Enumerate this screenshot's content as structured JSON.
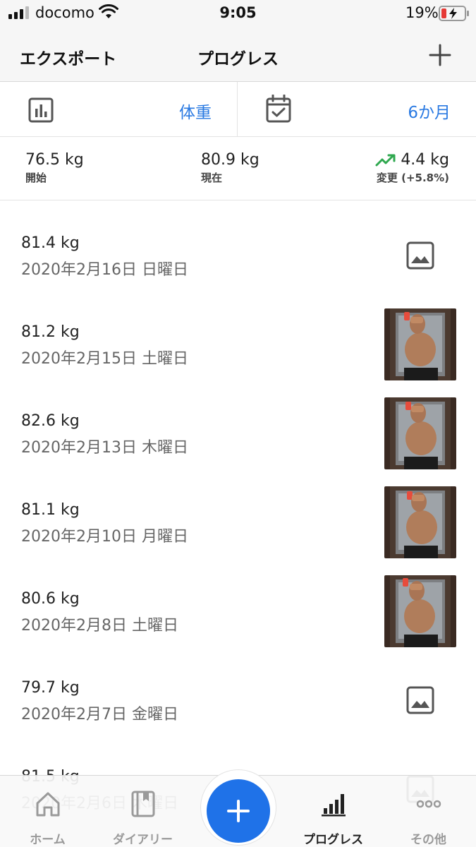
{
  "status_bar": {
    "carrier": "docomo",
    "time": "9:05",
    "battery_percent": "19%"
  },
  "nav": {
    "export_label": "エクスポート",
    "title": "プログレス",
    "add_icon": "plus-icon"
  },
  "filters": {
    "metric_icon": "bar-chart-icon",
    "metric": "体重",
    "period_icon": "calendar-check-icon",
    "period": "6か月"
  },
  "summary": {
    "start_value": "76.5 kg",
    "start_label": "開始",
    "current_value": "80.9 kg",
    "current_label": "現在",
    "change_value": "4.4 kg",
    "change_label": "変更 (+5.8%)",
    "trend_color": "#2fa84f"
  },
  "entries": [
    {
      "weight": "81.4 kg",
      "date": "2020年2月16日 日曜日",
      "has_photo": false
    },
    {
      "weight": "81.2 kg",
      "date": "2020年2月15日 土曜日",
      "has_photo": true
    },
    {
      "weight": "82.6 kg",
      "date": "2020年2月13日 木曜日",
      "has_photo": true
    },
    {
      "weight": "81.1 kg",
      "date": "2020年2月10日 月曜日",
      "has_photo": true
    },
    {
      "weight": "80.6 kg",
      "date": "2020年2月8日 土曜日",
      "has_photo": true
    },
    {
      "weight": "79.7 kg",
      "date": "2020年2月7日 金曜日",
      "has_photo": false
    },
    {
      "weight": "81.5 kg",
      "date": "2020年2月6日 木曜日",
      "has_photo": false
    }
  ],
  "tabs": [
    {
      "label": "ホーム",
      "icon": "home-icon",
      "active": false
    },
    {
      "label": "ダイアリー",
      "icon": "diary-book-icon",
      "active": false
    },
    {
      "label": "プログレス",
      "icon": "progress-bars-icon",
      "active": true
    },
    {
      "label": "その他",
      "icon": "more-dots-icon",
      "active": false
    }
  ],
  "accent_color": "#2a7ae2",
  "fab_color": "#1f72e8"
}
